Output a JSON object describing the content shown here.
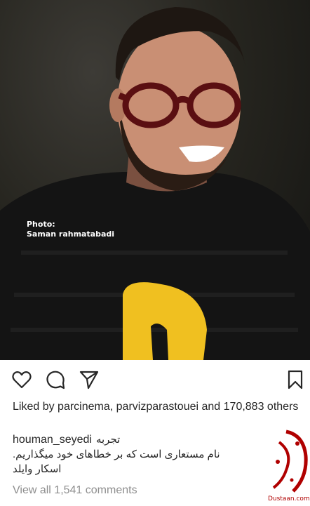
{
  "photo": {
    "credit_line1": "Photo:",
    "credit_line2": "Saman rahmatabadi",
    "shirt_letter_color": "#f0c020"
  },
  "actions": {
    "like_icon": "heart-icon",
    "comment_icon": "comment-icon",
    "share_icon": "paper-plane-icon",
    "save_icon": "bookmark-icon"
  },
  "likes": {
    "prefix": "Liked by ",
    "user1": "parcinema",
    "separator": ", ",
    "user2": "parvizparastouei",
    "middle": " and ",
    "count": "170,883",
    "suffix": " others"
  },
  "caption": {
    "username": "houman_seyedi",
    "title": "تجربه",
    "line1": "نام مستعاری است که بر خطاهای خود میگذاریم.",
    "line2": "اسکار وایلد"
  },
  "comments": {
    "view_all": "View all 1,541 comments"
  },
  "watermark": {
    "site": "Dustaan.com",
    "accent_color": "#b00000"
  }
}
